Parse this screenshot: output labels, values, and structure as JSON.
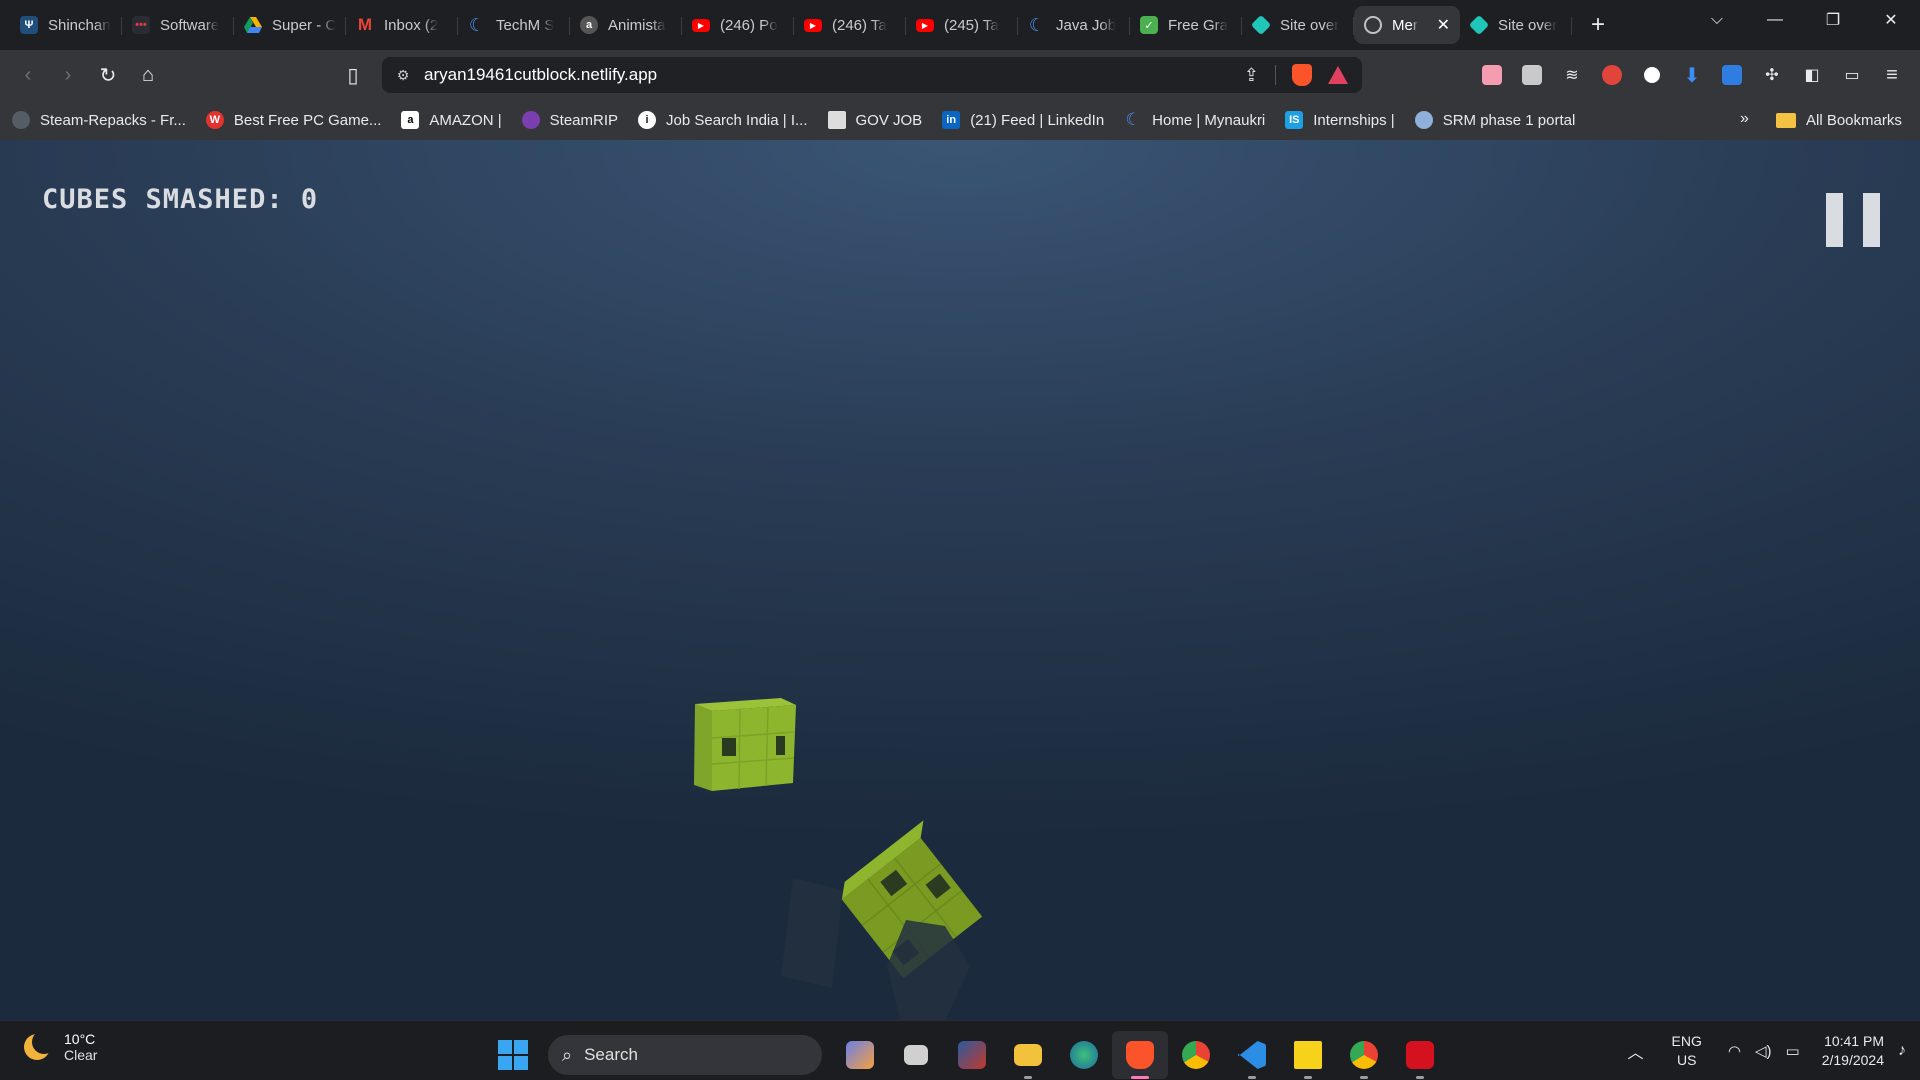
{
  "browser": {
    "tabs": [
      {
        "title": "Shinchan",
        "icon": "predator-icon",
        "color": "#4a9bd8"
      },
      {
        "title": "Software",
        "icon": "dots-icon",
        "color": "#e23b3b"
      },
      {
        "title": "Super - C",
        "icon": "drive-icon",
        "color": "#f4b400"
      },
      {
        "title": "Inbox (2",
        "icon": "gmail-icon",
        "color": "#ea4335"
      },
      {
        "title": "TechM S",
        "icon": "naukri-icon",
        "color": "#4c8bf5"
      },
      {
        "title": "Animista",
        "icon": "animista-icon",
        "color": "#555555"
      },
      {
        "title": "(246) Po",
        "icon": "youtube-icon",
        "color": "#ff0000"
      },
      {
        "title": "(246) Ta",
        "icon": "youtube-icon",
        "color": "#ff0000"
      },
      {
        "title": "(245) Ta",
        "icon": "youtube-icon",
        "color": "#ff0000"
      },
      {
        "title": "Java Job",
        "icon": "naukri-icon",
        "color": "#4c8bf5"
      },
      {
        "title": "Free Gra",
        "icon": "check-icon",
        "color": "#4caf50"
      },
      {
        "title": "Site over",
        "icon": "netlify-icon",
        "color": "#20c6b7"
      },
      {
        "title": "Mer",
        "icon": "globe-icon",
        "color": "#9aa0a6",
        "active": true
      },
      {
        "title": "Site over",
        "icon": "netlify-icon",
        "color": "#20c6b7"
      }
    ],
    "new_tab_label": "+",
    "url": "aryan19461cutblock.netlify.app",
    "bookmarks": [
      {
        "label": "Steam-Repacks - Fr...",
        "color": "#555c66"
      },
      {
        "label": "Best Free PC Game...",
        "color": "#e2332f"
      },
      {
        "label": "AMAZON |",
        "color": "#ffffff"
      },
      {
        "label": "SteamRIP",
        "color": "#7b3fb0"
      },
      {
        "label": "Job Search India | I...",
        "color": "#ffffff"
      },
      {
        "label": "GOV JOB",
        "color": "#dddddd"
      },
      {
        "label": "(21) Feed | LinkedIn",
        "color": "#0a66c2"
      },
      {
        "label": "Home | Mynaukri",
        "color": "#4c8bf5"
      },
      {
        "label": "Internships |",
        "color": "#1ea1e4"
      },
      {
        "label": "SRM phase 1 portal",
        "color": "#8fb0d8"
      }
    ],
    "bookmarks_overflow": "»",
    "all_bookmarks": "All Bookmarks"
  },
  "game": {
    "score_label": "CUBES SMASHED: 0",
    "accent": "#8db52e"
  },
  "taskbar": {
    "temperature": "10°C",
    "condition": "Clear",
    "search_placeholder": "Search",
    "language": "ENG",
    "region": "US",
    "time": "10:41 PM",
    "date": "2/19/2024",
    "apps": [
      {
        "name": "copilot-icon",
        "color": "#6b7fe8"
      },
      {
        "name": "task-view-icon",
        "color": "#d0d0d0"
      },
      {
        "name": "game-app-icon",
        "color": "#c0392b"
      },
      {
        "name": "file-explorer-icon",
        "color": "#f3c23c"
      },
      {
        "name": "network-app-icon",
        "color": "#2fa86a"
      },
      {
        "name": "brave-icon",
        "color": "#fb542b",
        "active": true
      },
      {
        "name": "chrome-icon",
        "color": "#4285f4"
      },
      {
        "name": "vscode-icon",
        "color": "#2b8de3"
      },
      {
        "name": "sticky-notes-icon",
        "color": "#f7d21a"
      },
      {
        "name": "chrome-profile-icon",
        "color": "#34a853"
      },
      {
        "name": "acrobat-icon",
        "color": "#d4111e"
      }
    ]
  }
}
